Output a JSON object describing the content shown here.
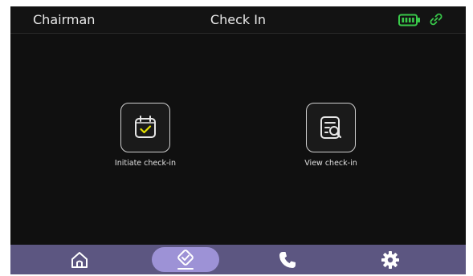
{
  "header": {
    "role": "Chairman",
    "title": "Check In"
  },
  "status_icons": {
    "battery": "battery-icon",
    "connection": "link-icon",
    "color": "#39c94a"
  },
  "actions": [
    {
      "label": "Initiate check-in",
      "icon": "calendar-check-icon"
    },
    {
      "label": "View check-in",
      "icon": "document-search-icon"
    }
  ],
  "navbar": {
    "items": [
      {
        "name": "home",
        "icon": "home-icon"
      },
      {
        "name": "check-in",
        "icon": "check-in-icon",
        "active": true
      },
      {
        "name": "phone",
        "icon": "phone-icon"
      },
      {
        "name": "settings",
        "icon": "gear-icon"
      }
    ],
    "background": "#5c5681",
    "active_color": "#9d92d6"
  },
  "accent_check": "#e4e000"
}
